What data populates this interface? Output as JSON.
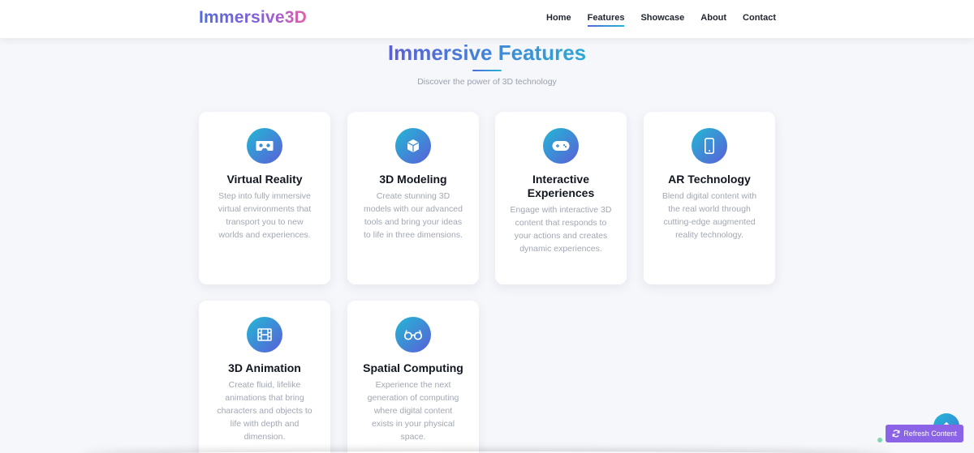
{
  "brand": {
    "logo": "Immersive3D"
  },
  "nav": {
    "items": [
      {
        "label": "Home"
      },
      {
        "label": "Features"
      },
      {
        "label": "Showcase"
      },
      {
        "label": "About"
      },
      {
        "label": "Contact"
      }
    ],
    "active": "Features"
  },
  "section": {
    "title": "Immersive Features",
    "subtitle": "Discover the power of 3D technology"
  },
  "features": [
    {
      "icon": "vr-headset-icon",
      "title": "Virtual Reality",
      "description": "Step into fully immersive virtual environments that transport you to new worlds and experiences."
    },
    {
      "icon": "cube-icon",
      "title": "3D Modeling",
      "description": "Create stunning 3D models with our advanced tools and bring your ideas to life in three dimensions."
    },
    {
      "icon": "gamepad-icon",
      "title": "Interactive Experiences",
      "description": "Engage with interactive 3D content that responds to your actions and creates dynamic experiences."
    },
    {
      "icon": "mobile-icon",
      "title": "AR Technology",
      "description": "Blend digital content with the real world through cutting-edge augmented reality technology."
    },
    {
      "icon": "film-icon",
      "title": "3D Animation",
      "description": "Create fluid, lifelike animations that bring characters and objects to life with depth and dimension."
    },
    {
      "icon": "glasses-icon",
      "title": "Spatial Computing",
      "description": "Experience the next generation of computing where digital content exists in your physical space."
    }
  ],
  "floating": {
    "refresh_label": "Refresh Content",
    "scroll_top_icon": "arrow-up-icon",
    "refresh_icon": "refresh-icon"
  },
  "colors": {
    "accent_start": "#4f6bdc",
    "accent_end": "#23b5d3",
    "refresh_button": "#8a63e6"
  }
}
